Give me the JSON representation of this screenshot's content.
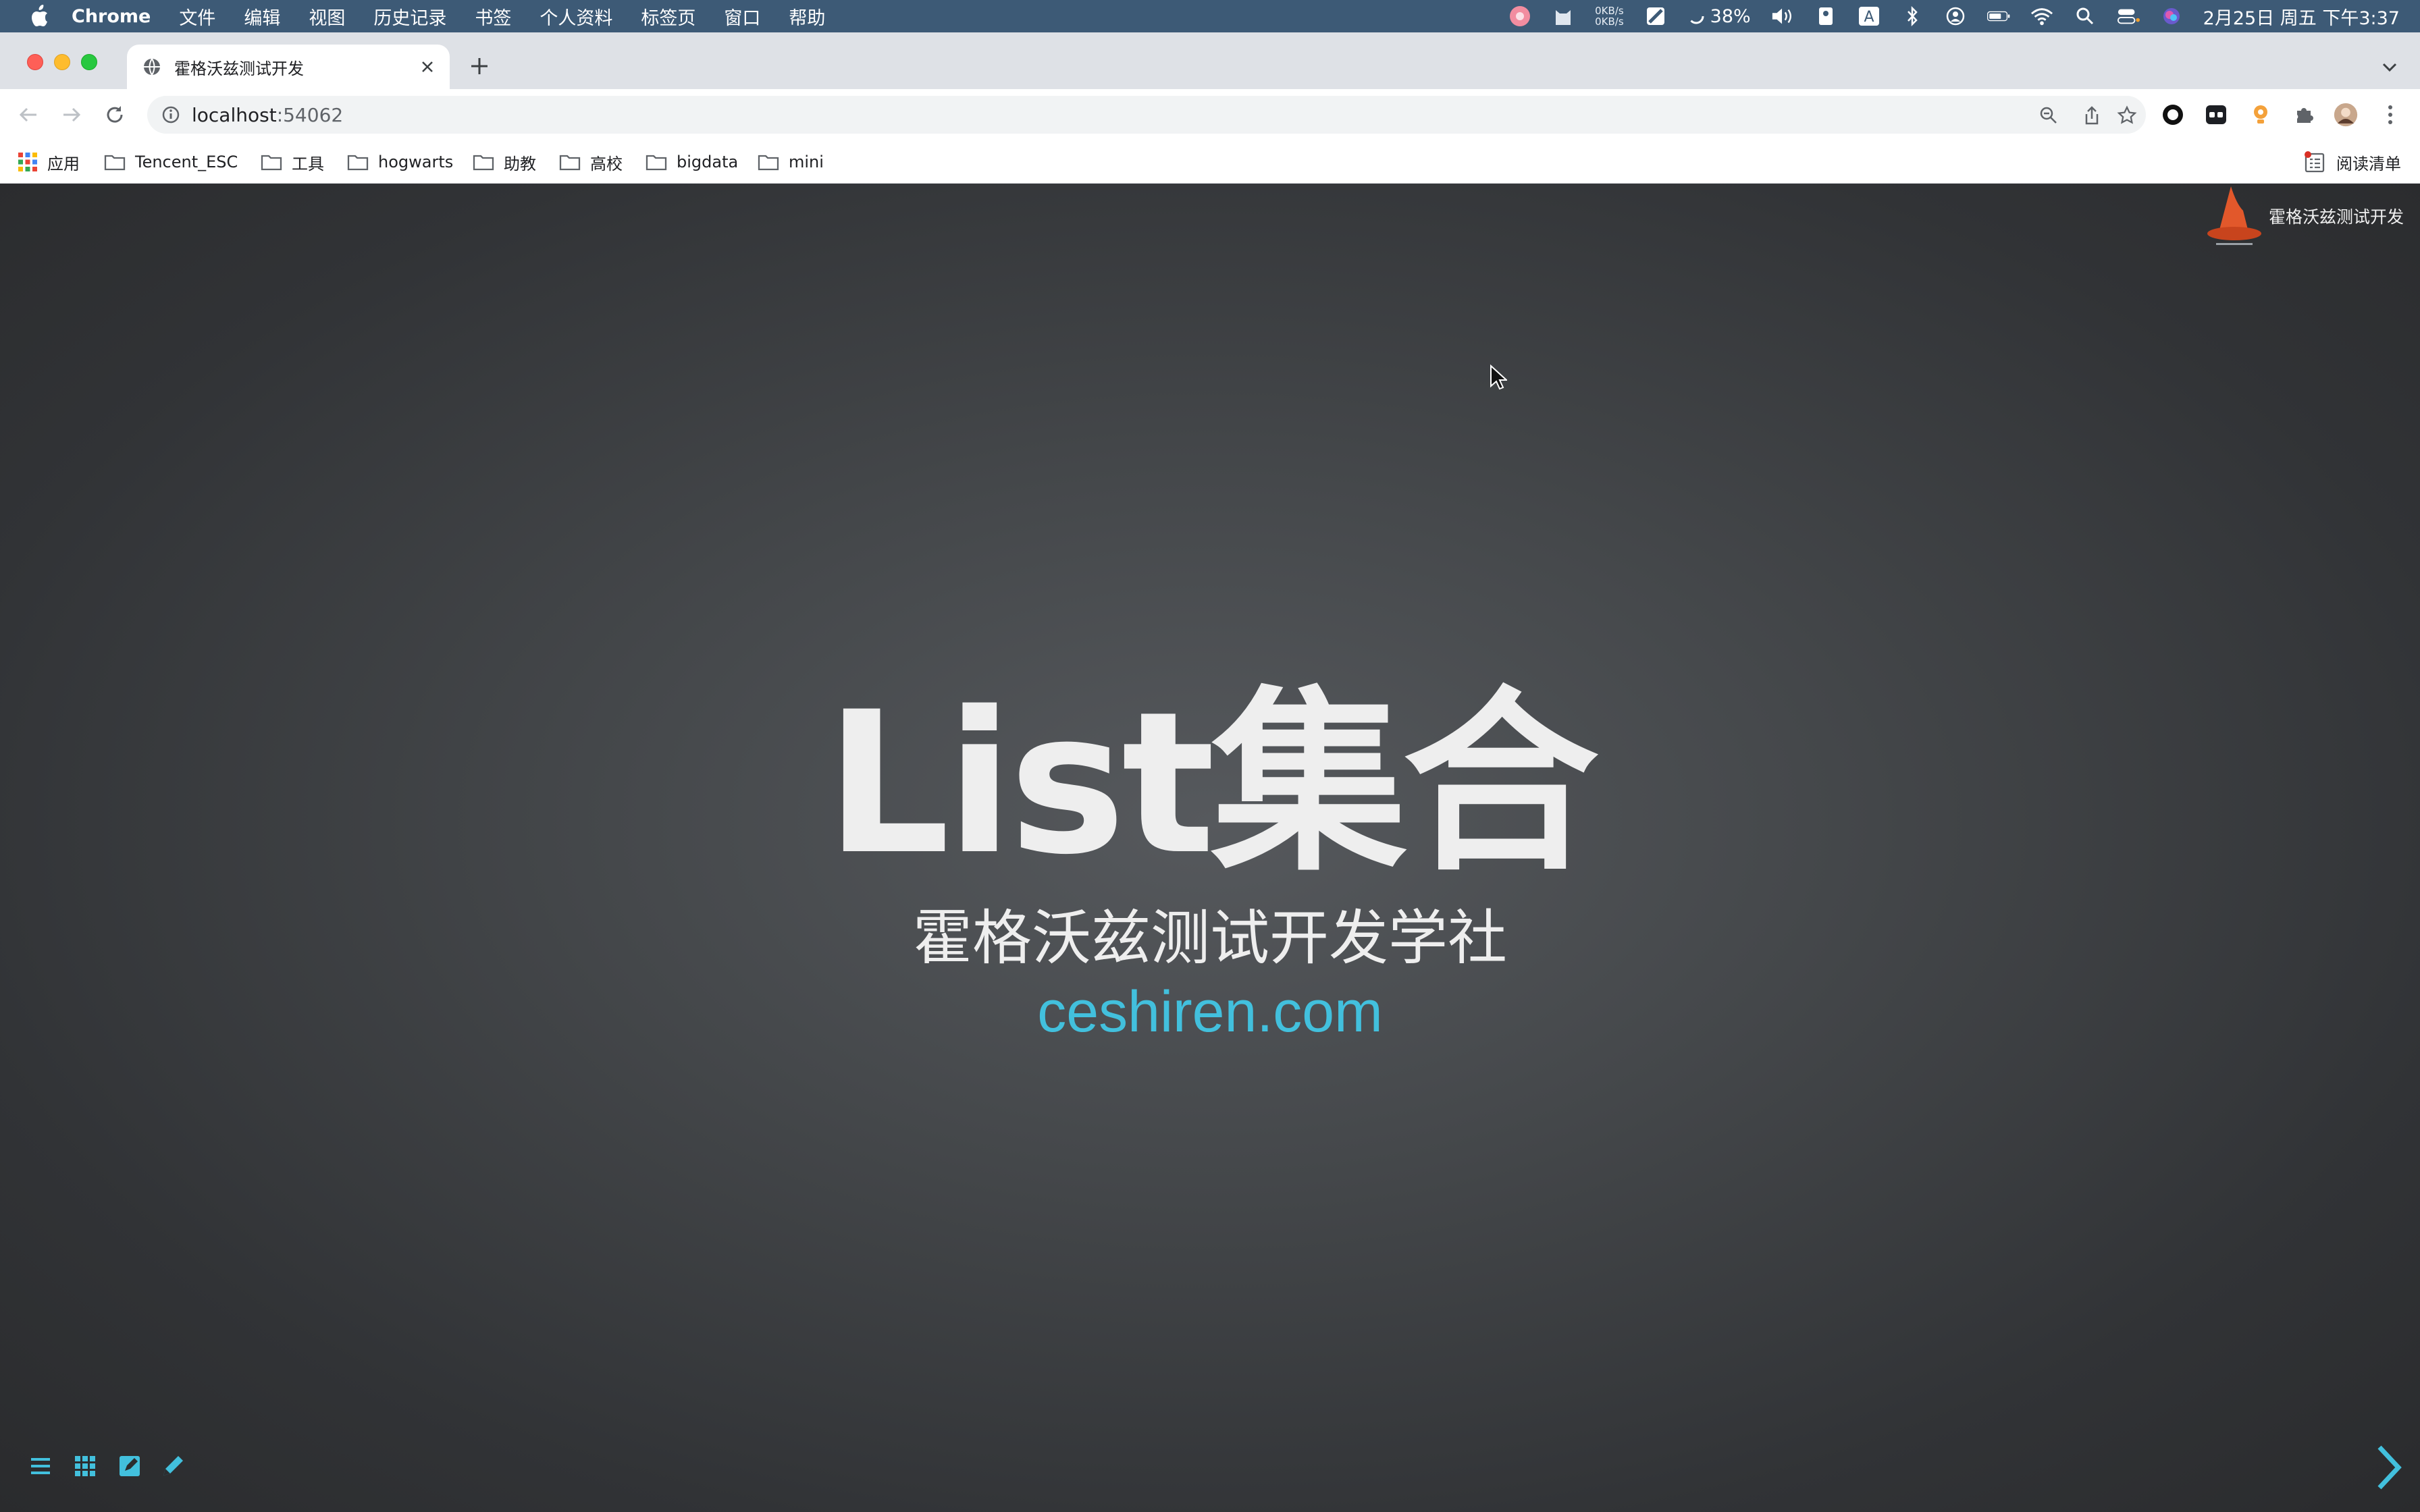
{
  "menubar": {
    "app": "Chrome",
    "items": [
      "文件",
      "编辑",
      "视图",
      "历史记录",
      "书签",
      "个人资料",
      "标签页",
      "窗口",
      "帮助"
    ],
    "net_up": "0KB/s",
    "net_down": "0KB/s",
    "cpu": "38%",
    "input_method": "A",
    "clock": "2月25日 周五 下午3:37"
  },
  "tab": {
    "title": "霍格沃兹测试开发"
  },
  "address": {
    "host": "localhost",
    "port": ":54062"
  },
  "bookmarks": {
    "apps": "应用",
    "items": [
      "Tencent_ESC",
      "工具",
      "hogwarts",
      "助教",
      "高校",
      "bigdata",
      "mini"
    ],
    "reading_list": "阅读清单"
  },
  "slide": {
    "brand": "霍格沃兹测试开发",
    "title": "List集合",
    "subtitle": "霍格沃兹测试开发学社",
    "site": "ceshiren.com",
    "accent": "#42c0dd"
  }
}
